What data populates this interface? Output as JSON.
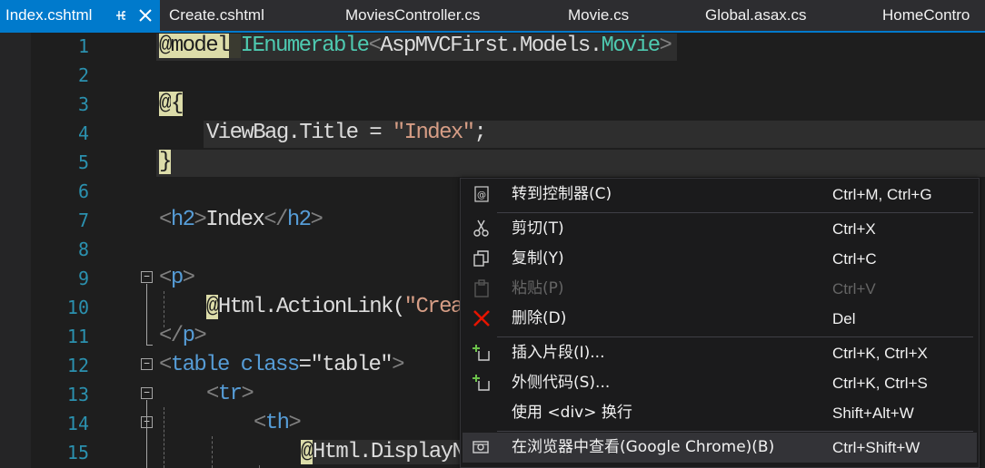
{
  "tabs": [
    {
      "label": "Index.cshtml",
      "active": true,
      "pin_icon": "pin-icon",
      "close_icon": "close-icon"
    },
    {
      "label": "Create.cshtml"
    },
    {
      "label": "MoviesController.cs"
    },
    {
      "label": "Movie.cs"
    },
    {
      "label": "Global.asax.cs"
    },
    {
      "label": "HomeContro"
    }
  ],
  "editor": {
    "line_numbers": [
      "1",
      "2",
      "3",
      "4",
      "5",
      "6",
      "7",
      "8",
      "9",
      "10",
      "11",
      "12",
      "13",
      "14",
      "15"
    ],
    "lines": {
      "l1": {
        "at": "@model",
        "type_prefix": "IEnumerable",
        "lt": "<",
        "ns": "AspMVCFirst.Models.",
        "type": "Movie",
        "gt": ">"
      },
      "l3": {
        "at": "@",
        "brace": "{"
      },
      "l4": {
        "name": "ViewBag.Title",
        "eq": " = ",
        "str": "\"Index\"",
        "semi": ";"
      },
      "l5": {
        "brace": "}"
      },
      "l7": {
        "open": "<",
        "tag": "h2",
        "close": ">",
        "text": "Index",
        "end_open": "</",
        "end_tag": "h2",
        "end_close": ">"
      },
      "l9": {
        "open": "<",
        "tag": "p",
        "close": ">"
      },
      "l10": {
        "at": "@",
        "call": "Html.ActionLink(",
        "str": "\"Crea"
      },
      "l11": {
        "open": "</",
        "tag": "p",
        "close": ">"
      },
      "l12": {
        "open": "<",
        "tag": "table",
        "attr": " class",
        "eq": "=",
        "str": "\"table\"",
        "close": ">"
      },
      "l13": {
        "open": "<",
        "tag": "tr",
        "close": ">"
      },
      "l14": {
        "open": "<",
        "tag": "th",
        "close": ">"
      },
      "l15": {
        "at": "@",
        "call": "Html.DisplayN"
      }
    }
  },
  "context_menu": {
    "items": [
      {
        "icon": "goto-controller-icon",
        "label": "转到控制器(C)",
        "shortcut": "Ctrl+M, Ctrl+G"
      },
      {
        "icon": "scissors-icon",
        "label": "剪切(T)",
        "shortcut": "Ctrl+X"
      },
      {
        "icon": "copy-icon",
        "label": "复制(Y)",
        "shortcut": "Ctrl+C"
      },
      {
        "icon": "paste-icon",
        "label": "粘贴(P)",
        "shortcut": "Ctrl+V",
        "disabled": true
      },
      {
        "icon": "delete-icon",
        "label": "删除(D)",
        "shortcut": "Del"
      },
      {
        "icon": "insert-snippet-icon",
        "label": "插入片段(I)...",
        "shortcut": "Ctrl+K, Ctrl+X"
      },
      {
        "icon": "surround-with-icon",
        "label": "外侧代码(S)...",
        "shortcut": "Ctrl+K, Ctrl+S"
      },
      {
        "icon": "",
        "label": "使用 <div> 换行",
        "shortcut": "Shift+Alt+W"
      },
      {
        "icon": "view-in-browser-icon",
        "label": "在浏览器中查看(Google Chrome)(B)",
        "shortcut": "Ctrl+Shift+W",
        "hover": true
      }
    ]
  },
  "colors": {
    "accent": "#007acc",
    "background": "#1e1e1e",
    "line_number": "#2b91af",
    "keyword": "#569cd6",
    "string": "#d69d85",
    "type": "#4ec9b0",
    "razor_highlight": "#dcdca9",
    "delete_icon": "#e51400"
  }
}
